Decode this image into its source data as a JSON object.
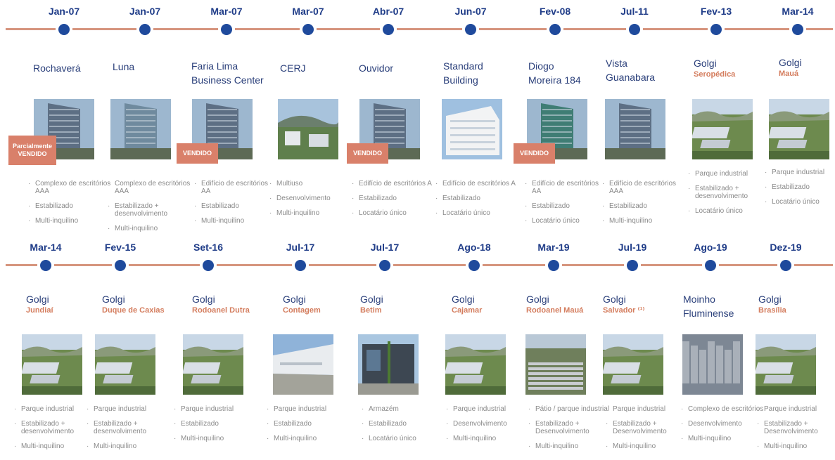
{
  "row1": [
    {
      "date": "Jan-07",
      "name": [
        "Rochaverá"
      ],
      "sub": "",
      "sold": "Parcialmente\nVENDIDO",
      "bullets": [
        "Complexo de escritórios AAA",
        "Estabilizado",
        "Multi-inquilino"
      ],
      "icon": "office-tower-image"
    },
    {
      "date": "Jan-07",
      "name": [
        "Luna"
      ],
      "sub": "",
      "sold": "",
      "bullets": [
        "Complexo de escritórios AAA",
        "Estabilizado + desenvolvimento",
        "Multi-inquilino"
      ],
      "icon": "glass-tower-image"
    },
    {
      "date": "Mar-07",
      "name": [
        "Faria Lima",
        "Business Center"
      ],
      "sub": "",
      "sold": "VENDIDO",
      "bullets": [
        "Edifício de escritórios AA",
        "Estabilizado",
        "Multi-inquilino"
      ],
      "icon": "office-building-image"
    },
    {
      "date": "Mar-07",
      "name": [
        "CERJ"
      ],
      "sub": "",
      "sold": "",
      "bullets": [
        "Multiuso",
        "Desenvolvimento",
        "Multi-inquilino"
      ],
      "icon": "campus-image"
    },
    {
      "date": "Abr-07",
      "name": [
        "Ouvidor"
      ],
      "sub": "",
      "sold": "VENDIDO",
      "bullets": [
        "Edifício de escritórios A",
        "Estabilizado",
        "Locatário único"
      ],
      "icon": "street-building-image"
    },
    {
      "date": "Jun-07",
      "name": [
        "Standard",
        "Building"
      ],
      "sub": "",
      "sold": "",
      "bullets": [
        "Edifício de escritórios A",
        "Estabilizado",
        "Locatário único"
      ],
      "icon": "white-building-image"
    },
    {
      "date": "Fev-08",
      "name": [
        "Diogo",
        "Moreira 184"
      ],
      "sub": "",
      "sold": "VENDIDO",
      "bullets": [
        "Edifício de escritórios AA",
        "Estabilizado",
        "Locatário único"
      ],
      "icon": "green-glass-tower-image"
    },
    {
      "date": "Jul-11",
      "name": [
        "Vista",
        "Guanabara"
      ],
      "sub": "",
      "sold": "",
      "bullets": [
        "Edifício de escritórios AAA",
        "Estabilizado",
        "Multi-inquilino"
      ],
      "icon": "city-tower-image"
    },
    {
      "date": "Fev-13",
      "name": [
        "Golgi"
      ],
      "sub": "Seropédica",
      "sold": "",
      "bullets": [
        "Parque industrial",
        "Estabilizado + desenvolvimento",
        "Locatário único"
      ],
      "icon": "industrial-park-image"
    },
    {
      "date": "Mar-14",
      "name": [
        "Golgi"
      ],
      "sub": "Mauá",
      "sold": "",
      "bullets": [
        "Parque industrial",
        "Estabilizado",
        "Locatário único"
      ],
      "icon": "warehouse-aerial-image"
    }
  ],
  "row2": [
    {
      "date": "Mar-14",
      "name": [
        "Golgi"
      ],
      "sub": "Jundiaí",
      "bullets": [
        "Parque industrial",
        "Estabilizado + desenvolvimento",
        "Multi-inquilino"
      ],
      "icon": "warehouse-aerial-image"
    },
    {
      "date": "Fev-15",
      "name": [
        "Golgi"
      ],
      "sub": "Duque de Caxias",
      "bullets": [
        "Parque industrial",
        "Estabilizado + desenvolvimento",
        "Multi-inquilino"
      ],
      "icon": "warehouse-aerial-image"
    },
    {
      "date": "Set-16",
      "name": [
        "Golgi"
      ],
      "sub": "Rodoanel Dutra",
      "bullets": [
        "Parque industrial",
        "Estabilizado",
        "Multi-inquilino"
      ],
      "icon": "warehouse-aerial-image"
    },
    {
      "date": "Jul-17",
      "name": [
        "Golgi"
      ],
      "sub": "Contagem",
      "bullets": [
        "Parque industrial",
        "Estabilizado",
        "Multi-inquilino"
      ],
      "icon": "warehouse-front-image"
    },
    {
      "date": "Jul-17",
      "name": [
        "Golgi"
      ],
      "sub": "Betim",
      "bullets": [
        "Armazém",
        "Estabilizado",
        "Locatário único"
      ],
      "icon": "warehouse-entrance-image"
    },
    {
      "date": "Ago-18",
      "name": [
        "Golgi"
      ],
      "sub": "Cajamar",
      "bullets": [
        "Parque industrial",
        "Desenvolvimento",
        "Multi-inquilino"
      ],
      "icon": "warehouse-render-image"
    },
    {
      "date": "Mar-19",
      "name": [
        "Golgi"
      ],
      "sub": "Rodoanel Mauá",
      "bullets": [
        "Pátio / parque industrial",
        "Estabilizado + Desenvolvimento",
        "Multi-inquilino"
      ],
      "icon": "truck-yard-image"
    },
    {
      "date": "Jul-19",
      "name": [
        "Golgi"
      ],
      "sub": "Salvador ⁽¹⁾",
      "bullets": [
        "Parque industrial",
        "Estabilizado + Desenvolvimento",
        "Multi-inquilino"
      ],
      "icon": "warehouse-aerial-image"
    },
    {
      "date": "Ago-19",
      "name": [
        "Moinho",
        "Fluminense"
      ],
      "sub": "",
      "bullets": [
        "Complexo de escritórios",
        "Desenvolvimento",
        "Multi-inquilino"
      ],
      "icon": "historic-complex-image"
    },
    {
      "date": "Dez-19",
      "name": [
        "Golgi"
      ],
      "sub": "Brasília",
      "bullets": [
        "Parque industrial",
        "Estabilizado + Desenvolvimento",
        "Multi-inquilino"
      ],
      "icon": "warehouse-aerial-image"
    }
  ],
  "colors": {
    "accent": "#1f3c88",
    "line": "#d6957e",
    "sold": "#d9806a",
    "sub": "#d47d5e",
    "bullet": "#8a8a8a"
  }
}
